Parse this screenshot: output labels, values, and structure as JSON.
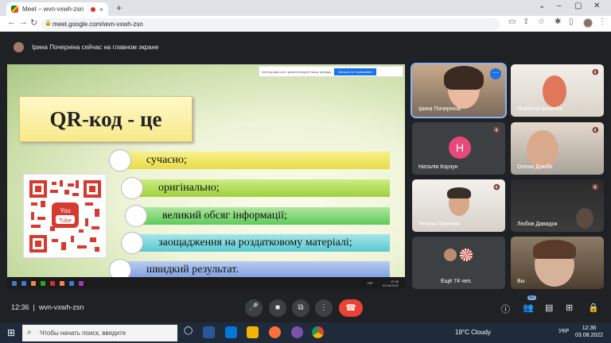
{
  "browser": {
    "tab_title": "Meet – wvn-vxwh-zsn",
    "url": "meet.google.com/wvn-vxwh-zsn",
    "new_tab": "+",
    "close": "×"
  },
  "banner": {
    "text": "Ірина Почерніна сейчас на главном экране"
  },
  "slide": {
    "top_bar_text": "meet.google.com: демонстрирует вашу вкладку",
    "top_bar_button": "Больше не показывать",
    "title": "QR-код - це",
    "qr_label": "You Tube",
    "items": [
      "сучасно;",
      "оригінально;",
      "великий обсяг інформації;",
      "заощадження на роздатковому матеріалі;",
      "швидкий результат."
    ],
    "inner_clock": "12:36\n03.08.2022",
    "inner_lang": "УКР"
  },
  "participants": [
    {
      "name": "Ірина Почерніна"
    },
    {
      "name": "ekaterina bosenko"
    },
    {
      "name": "Наталія Корзун",
      "initial": "Н"
    },
    {
      "name": "Олена Дзюба"
    },
    {
      "name": "Тетяна Гуменюк"
    },
    {
      "name": "Любов Давидок"
    },
    {
      "name": "Ещё 74 чел."
    },
    {
      "name": "Вы"
    }
  ],
  "controls": {
    "time": "12:36",
    "meeting_code": "wvn-vxwh-zsn",
    "participant_count": "82"
  },
  "taskbar": {
    "search_placeholder": "Чтобы начать поиск, введите",
    "weather": "19°C Cloudy",
    "lang": "УКР",
    "clock_time": "12:36",
    "clock_date": "03.08.2022"
  }
}
